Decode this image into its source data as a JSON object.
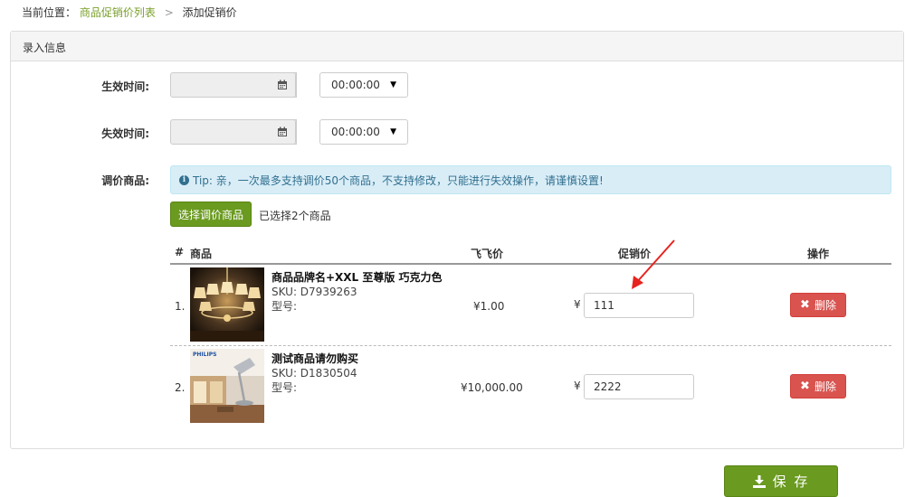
{
  "breadcrumb": {
    "prefix": "当前位置：",
    "link": "商品促销价列表",
    "separator": ">",
    "current": "添加促销价"
  },
  "panel": {
    "title": "录入信息"
  },
  "form": {
    "effective_label": "生效时间:",
    "effective_time": "00:00:00",
    "expire_label": "失效时间:",
    "expire_time": "00:00:00",
    "products_label": "调价商品:",
    "tip_text": "Tip: 亲，一次最多支持调价50个商品，不支持修改，只能进行失效操作，请谨慎设置!",
    "select_button": "选择调价商品",
    "selected_count": "已选择2个商品"
  },
  "table": {
    "headers": {
      "index": "#",
      "product": "商品",
      "price": "飞飞价",
      "promo_price": "促销价",
      "action": "操作"
    },
    "rows": [
      {
        "index": "1.",
        "name": "商品品牌名+XXL 至尊版 巧克力色",
        "sku": "SKU: D7939263",
        "model": "型号:",
        "price": "¥1.00",
        "currency": "¥",
        "promo_price": "111",
        "delete_label": "删除",
        "image_icon": "chandelier-image"
      },
      {
        "index": "2.",
        "name": "测试商品请勿购买",
        "sku": "SKU: D1830504",
        "model": "型号:",
        "price": "¥10,000.00",
        "currency": "¥",
        "promo_price": "2222",
        "delete_label": "删除",
        "image_icon": "desk-lamp-image",
        "brand": "PHILIPS"
      }
    ]
  },
  "save_button": "保 存",
  "colors": {
    "primary_green": "#6a9a1f",
    "danger_red": "#d9534f",
    "info_bg": "#d9edf7",
    "annotation_red": "#e8231e"
  }
}
